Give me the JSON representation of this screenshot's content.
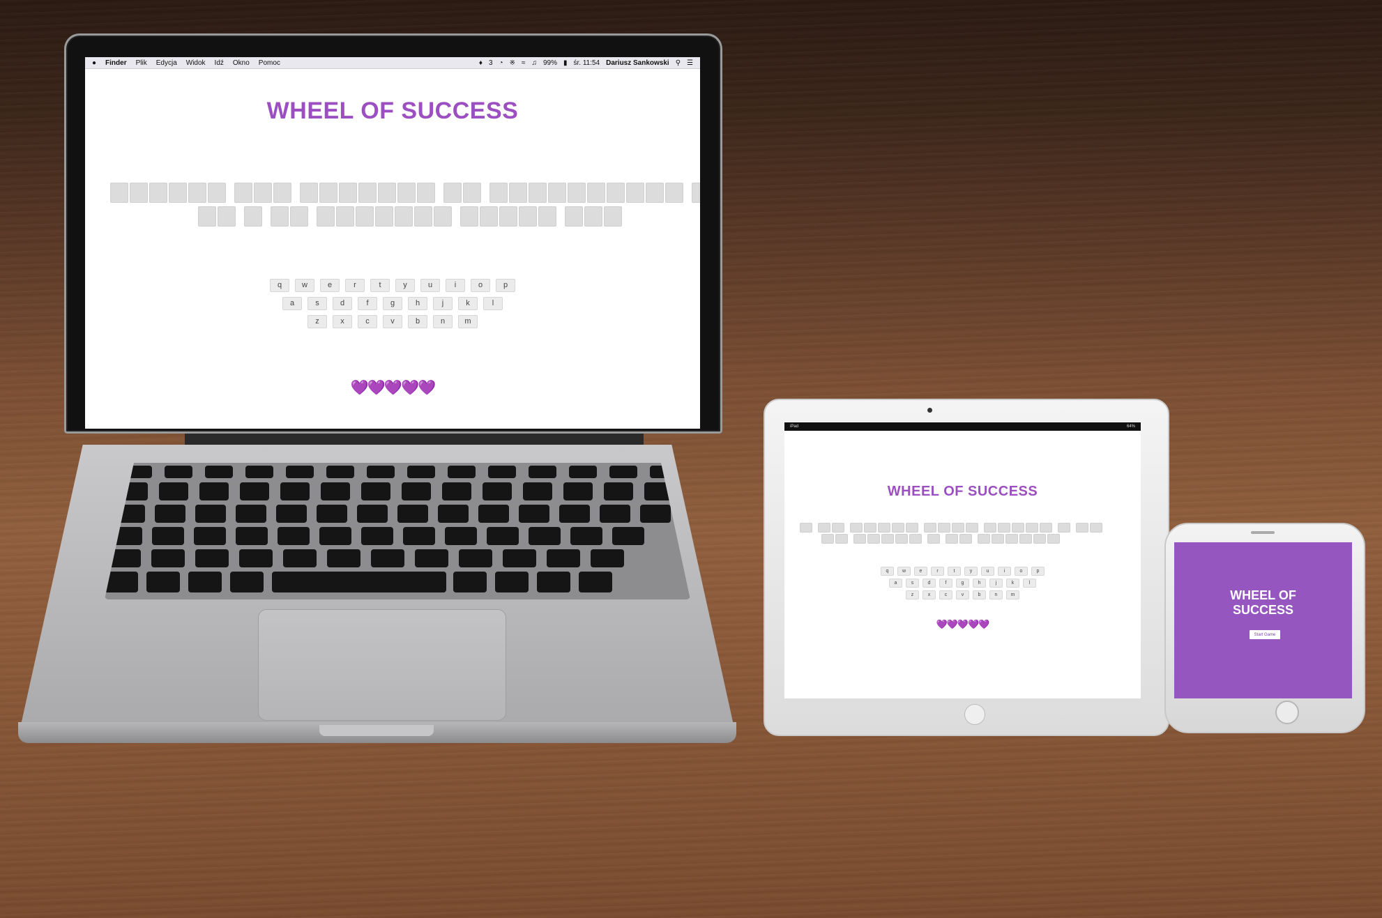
{
  "menubar": {
    "app": "Finder",
    "items": [
      "Plik",
      "Edycja",
      "Widok",
      "Idź",
      "Okno",
      "Pomoc"
    ],
    "status": {
      "battery": "99%",
      "clock": "śr. 11:54",
      "user": "Dariusz Sankowski",
      "notifications": "3"
    }
  },
  "game": {
    "title": "WHEEL OF SUCCESS",
    "mobile_title_line1": "WHEEL OF",
    "mobile_title_line2": "SUCCESS",
    "start_button": "Start Game",
    "hearts": "💜💜💜💜💜",
    "keyboard_rows": [
      [
        "q",
        "w",
        "e",
        "r",
        "t",
        "y",
        "u",
        "i",
        "o",
        "p"
      ],
      [
        "a",
        "s",
        "d",
        "f",
        "g",
        "h",
        "j",
        "k",
        "l"
      ],
      [
        "z",
        "x",
        "c",
        "v",
        "b",
        "n",
        "m"
      ]
    ],
    "laptop_puzzle_lines": [
      [
        6,
        3,
        7,
        2,
        10,
        1
      ],
      [
        2,
        1,
        2,
        7,
        5,
        3
      ]
    ],
    "tablet_puzzle_lines": [
      [
        1,
        2,
        5,
        4,
        5,
        1,
        2
      ],
      [
        2,
        5,
        1,
        2,
        6
      ]
    ]
  },
  "tablet_statusbar": {
    "device": "iPad",
    "battery": "64%"
  },
  "colors": {
    "accent": "#9b4fc0",
    "tile": "#dcdcdc",
    "heart": "#b044e0"
  }
}
